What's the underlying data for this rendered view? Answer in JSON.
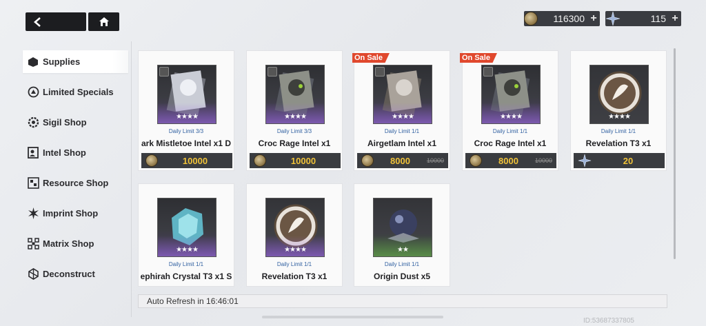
{
  "currency": {
    "coins": {
      "value": "116300",
      "icon": "coin-icon"
    },
    "stars": {
      "value": "115",
      "icon": "star-crystal-icon"
    }
  },
  "sidebar": {
    "items": [
      {
        "label": "Supplies",
        "icon": "supplies-icon",
        "active": true
      },
      {
        "label": "Limited Specials",
        "icon": "limited-specials-icon"
      },
      {
        "label": "Sigil Shop",
        "icon": "sigil-icon"
      },
      {
        "label": "Intel Shop",
        "icon": "intel-icon"
      },
      {
        "label": "Resource Shop",
        "icon": "resource-icon"
      },
      {
        "label": "Imprint Shop",
        "icon": "imprint-icon"
      },
      {
        "label": "Matrix Shop",
        "icon": "matrix-icon"
      },
      {
        "label": "Deconstruct",
        "icon": "deconstruct-icon"
      }
    ]
  },
  "items": [
    {
      "name": "ark Mistletoe Intel x1  D",
      "daily_label": "Daily Limit",
      "daily": "3/3",
      "price": "10000",
      "currency": "coin",
      "stars": "★★★★"
    },
    {
      "name": "Croc Rage Intel x1",
      "daily_label": "Daily Limit",
      "daily": "3/3",
      "price": "10000",
      "currency": "coin",
      "stars": "★★★★"
    },
    {
      "name": "Airgetlam Intel x1",
      "daily_label": "Daily Limit",
      "daily": "1/1",
      "price": "8000",
      "old_price": "10000",
      "currency": "coin",
      "on_sale": "On Sale",
      "stars": "★★★★"
    },
    {
      "name": "Croc Rage Intel x1",
      "daily_label": "Daily Limit",
      "daily": "1/1",
      "price": "8000",
      "old_price": "10000",
      "currency": "coin",
      "on_sale": "On Sale",
      "stars": "★★★★"
    },
    {
      "name": "Revelation T3 x1",
      "daily_label": "Daily Limit",
      "daily": "1/1",
      "price": "20",
      "currency": "star",
      "stars": "★★★★"
    },
    {
      "name": "ephirah Crystal T3 x1  S",
      "daily_label": "Daily Limit",
      "daily": "1/1",
      "stars": "★★★★"
    },
    {
      "name": "Revelation T3 x1",
      "daily_label": "Daily Limit",
      "daily": "1/1",
      "stars": "★★★★"
    },
    {
      "name": "Origin Dust x5",
      "daily_label": "Daily Limit",
      "daily": "1/1",
      "stars": "★★"
    }
  ],
  "footer": {
    "refresh": "Auto Refresh in 16:46:01",
    "uid": "ID:53687337805"
  }
}
